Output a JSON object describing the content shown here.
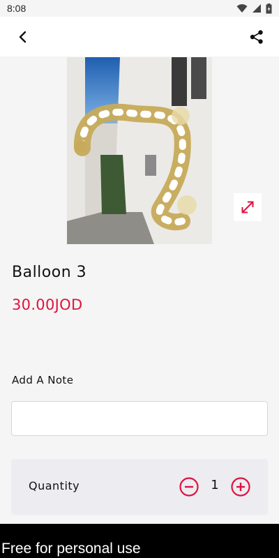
{
  "status_bar": {
    "time": "8:08",
    "icons": [
      "wifi-icon",
      "signal-icon",
      "battery-icon"
    ]
  },
  "app_bar": {
    "back_icon": "chevron-left-icon",
    "share_icon": "share-icon"
  },
  "product": {
    "name": "Balloon 3",
    "price": "30.00JOD",
    "image_alt": "balloon-arch-photo",
    "expand_icon": "expand-icon"
  },
  "note": {
    "label": "Add A Note",
    "value": "",
    "placeholder": ""
  },
  "quantity": {
    "label": "Quantity",
    "value": "1",
    "minus_icon": "minus-circle-icon",
    "plus_icon": "plus-circle-icon"
  },
  "footer": {
    "text": "Free for personal use"
  },
  "colors": {
    "accent": "#e0123f",
    "background": "#f5f5f5",
    "card": "#ececf1"
  }
}
